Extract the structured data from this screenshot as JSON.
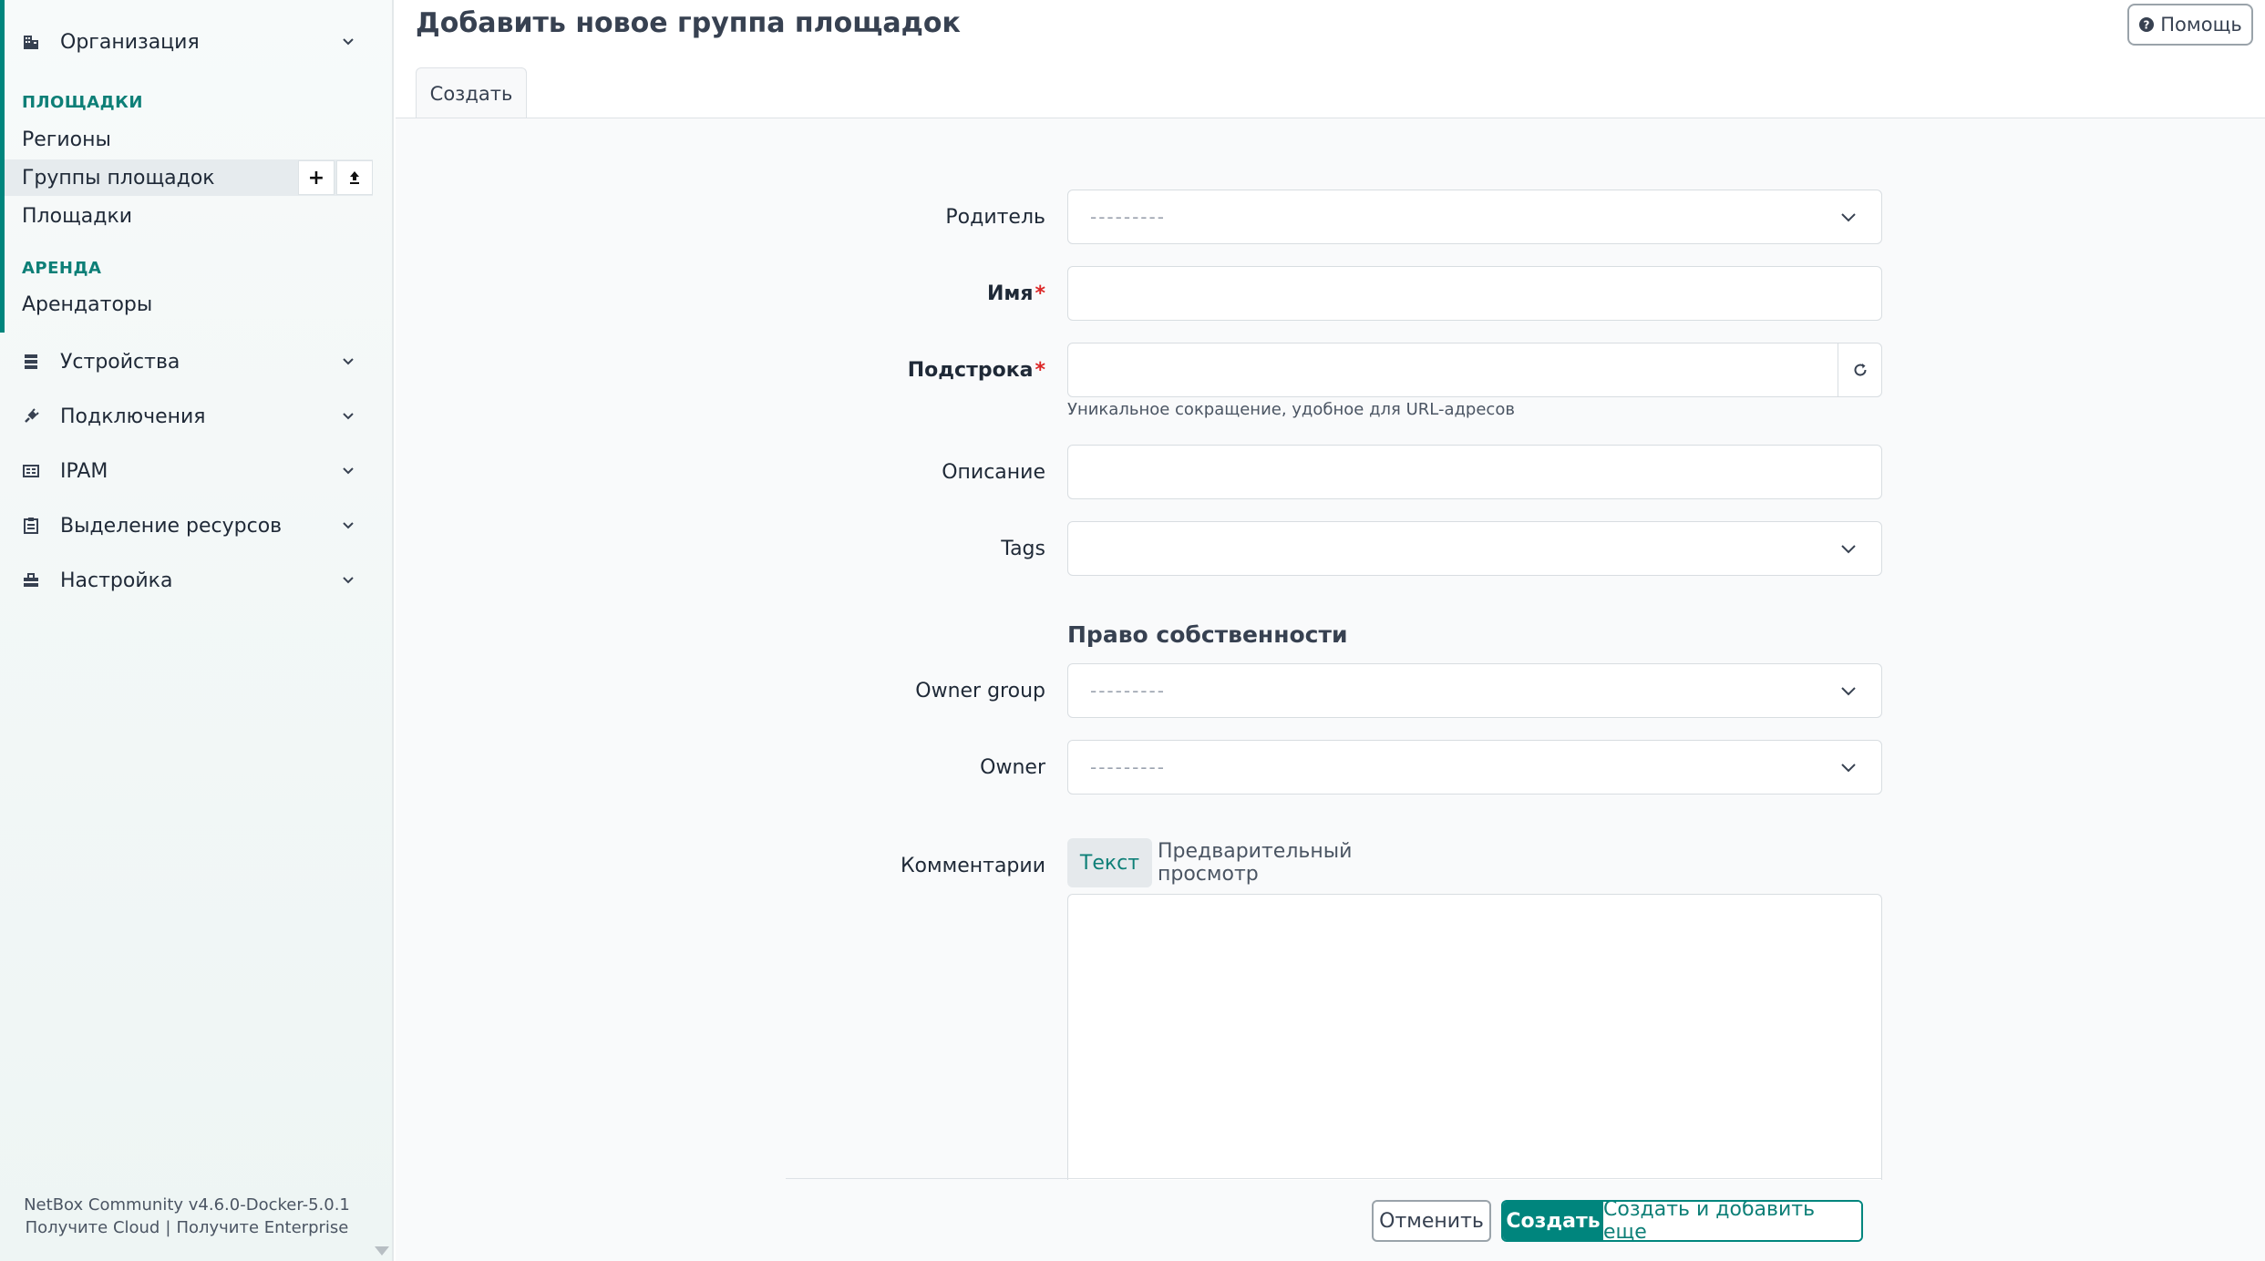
{
  "sidebar": {
    "org_section": {
      "label": "Организация",
      "icon": "building-icon"
    },
    "groups": [
      {
        "heading": "ПЛОЩАДКИ",
        "items": [
          "Регионы",
          "Группы площадок",
          "Площадки"
        ]
      },
      {
        "heading": "АРЕНДА",
        "items": [
          "Арендаторы"
        ]
      }
    ],
    "active_item": "Группы площадок",
    "active_item_actions": {
      "add": "+",
      "import": "⬆"
    },
    "sections": [
      {
        "label": "Устройства",
        "icon": "server-icon"
      },
      {
        "label": "Подключения",
        "icon": "plug-icon"
      },
      {
        "label": "IPAM",
        "icon": "ipam-icon"
      },
      {
        "label": "Выделение ресурсов",
        "icon": "clipboard-icon"
      },
      {
        "label": "Настройка",
        "icon": "toolbox-icon"
      }
    ],
    "footer": {
      "version": "NetBox Community v4.6.0-Docker-5.0.1",
      "link_cloud": "Получите Cloud",
      "separator": "|",
      "link_enterprise": "Получите Enterprise"
    }
  },
  "header": {
    "title": "Добавить новое группа площадок",
    "help_label": "Помощь"
  },
  "tabs": [
    {
      "label": "Создать"
    }
  ],
  "form": {
    "parent": {
      "label": "Родитель",
      "placeholder": "---------"
    },
    "name": {
      "label": "Имя",
      "required_mark": "*",
      "value": ""
    },
    "slug": {
      "label": "Подстрока",
      "required_mark": "*",
      "value": "",
      "help": "Уникальное сокращение, удобное для URL-адресов"
    },
    "description": {
      "label": "Описание",
      "value": ""
    },
    "tags": {
      "label": "Tags",
      "value": ""
    },
    "ownership_title": "Право собственности",
    "owner_group": {
      "label": "Owner group",
      "placeholder": "---------"
    },
    "owner": {
      "label": "Owner",
      "placeholder": "---------"
    },
    "comments": {
      "label": "Комментарии",
      "tab_text": "Текст",
      "tab_preview": "Предварительный просмотр",
      "value": ""
    }
  },
  "actions": {
    "cancel": "Отменить",
    "create": "Создать",
    "create_and_add": "Создать и добавить еще"
  },
  "colors": {
    "accent": "#00857d",
    "required": "#dc2626"
  }
}
